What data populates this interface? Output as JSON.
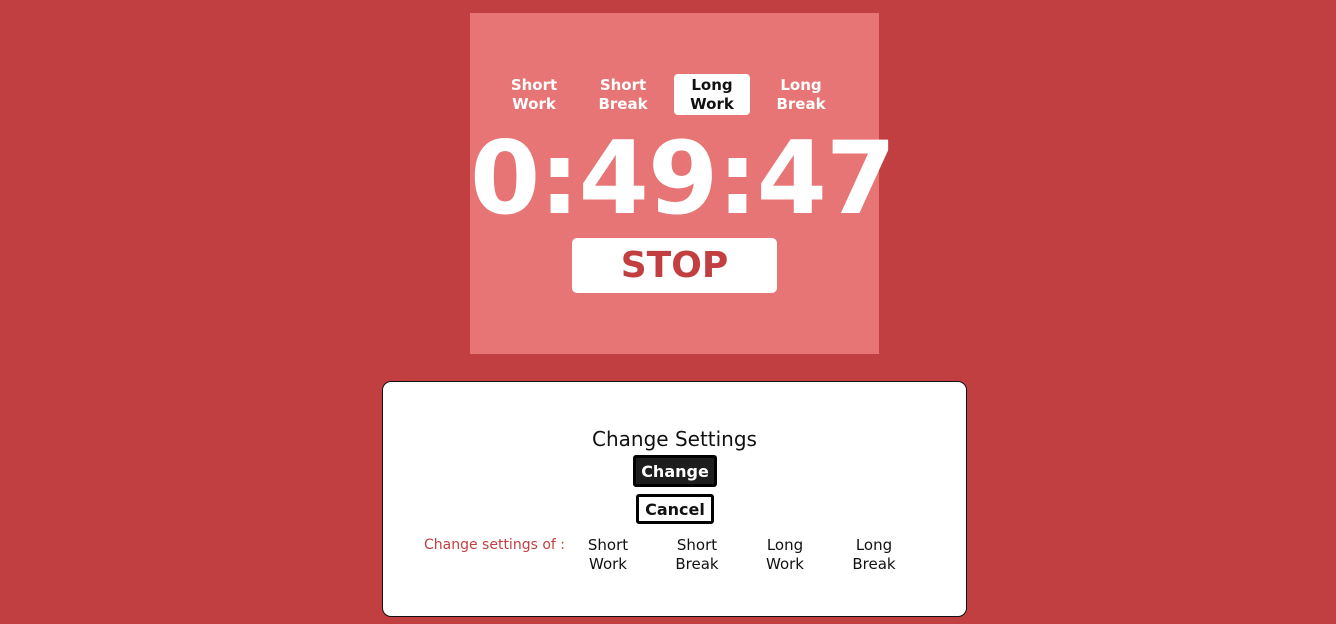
{
  "timer": {
    "tabs": [
      {
        "label": "Short\nWork",
        "active": false
      },
      {
        "label": "Short\nBreak",
        "active": false
      },
      {
        "label": "Long\nWork",
        "active": true
      },
      {
        "label": "Long\nBreak",
        "active": false
      }
    ],
    "time": "0:49:47",
    "stop_label": "STOP"
  },
  "settings": {
    "title": "Change Settings",
    "change_label": "Change",
    "cancel_label": "Cancel",
    "of_label": "Change settings of :",
    "options": [
      {
        "label": "Short\nWork"
      },
      {
        "label": "Short\nBreak"
      },
      {
        "label": "Long\nWork"
      },
      {
        "label": "Long\nBreak"
      }
    ]
  },
  "colors": {
    "background": "#c13f40",
    "panel": "#e87575",
    "accent": "#c13f40"
  }
}
